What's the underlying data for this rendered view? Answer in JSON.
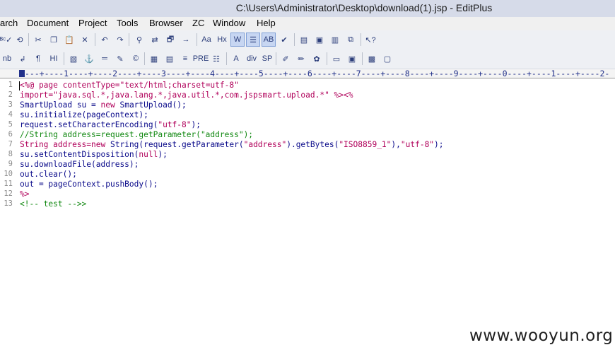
{
  "window": {
    "title": "C:\\Users\\Administrator\\Desktop\\download(1).jsp - EditPlus"
  },
  "menu": [
    "arch",
    "Document",
    "Project",
    "Tools",
    "Browser",
    "ZC",
    "Window",
    "Help"
  ],
  "toolbar1": {
    "buttons": [
      {
        "icon": "spell-check-icon",
        "glyph": "ᴬᴮᶜ✓"
      },
      {
        "icon": "browser-preview-icon",
        "glyph": "⟲"
      },
      {
        "icon": "cut-icon",
        "glyph": "✂"
      },
      {
        "icon": "copy-icon",
        "glyph": "❐"
      },
      {
        "icon": "paste-icon",
        "glyph": "📋"
      },
      {
        "icon": "delete-icon",
        "glyph": "✕"
      },
      {
        "icon": "undo-icon",
        "glyph": "↶"
      },
      {
        "icon": "redo-icon",
        "glyph": "↷"
      },
      {
        "icon": "find-icon",
        "glyph": "⚲"
      },
      {
        "icon": "replace-icon",
        "glyph": "⇄"
      },
      {
        "icon": "find-in-files-icon",
        "glyph": "🗗"
      },
      {
        "icon": "goto-line-icon",
        "glyph": "→"
      },
      {
        "icon": "font-icon",
        "glyph": "Aa"
      },
      {
        "icon": "hex-icon",
        "glyph": "Hx"
      },
      {
        "icon": "word-wrap-icon",
        "glyph": "W"
      },
      {
        "icon": "indent-icon",
        "glyph": "☰"
      },
      {
        "icon": "abc-sort-icon",
        "glyph": "AB"
      },
      {
        "icon": "check-icon",
        "glyph": "✔"
      },
      {
        "icon": "directory-icon",
        "glyph": "▤"
      },
      {
        "icon": "cliptext-icon",
        "glyph": "▣"
      },
      {
        "icon": "output-window-icon",
        "glyph": "▥"
      },
      {
        "icon": "window-icon",
        "glyph": "⧉"
      },
      {
        "icon": "help-icon",
        "glyph": "↖?"
      }
    ]
  },
  "toolbar2": {
    "buttons": [
      {
        "icon": "nbsp-icon",
        "glyph": "nb"
      },
      {
        "icon": "line-break-icon",
        "glyph": "↲"
      },
      {
        "icon": "paragraph-icon",
        "glyph": "¶"
      },
      {
        "icon": "heading-icon",
        "glyph": "HI"
      },
      {
        "icon": "image-icon",
        "glyph": "▧"
      },
      {
        "icon": "anchor-icon",
        "glyph": "⚓"
      },
      {
        "icon": "horizontal-rule-icon",
        "glyph": "═"
      },
      {
        "icon": "pencil-icon",
        "glyph": "✎"
      },
      {
        "icon": "copyright-icon",
        "glyph": "©"
      },
      {
        "icon": "table-icon",
        "glyph": "▦"
      },
      {
        "icon": "table-row-icon",
        "glyph": "▤"
      },
      {
        "icon": "center-icon",
        "glyph": "≡"
      },
      {
        "icon": "pre-icon",
        "glyph": "PRE"
      },
      {
        "icon": "list-icon",
        "glyph": "☷"
      },
      {
        "icon": "font-tag-icon",
        "glyph": "A"
      },
      {
        "icon": "div-icon",
        "glyph": "div"
      },
      {
        "icon": "span-icon",
        "glyph": "SP"
      },
      {
        "icon": "edit-icon",
        "glyph": "✐"
      },
      {
        "icon": "comment-icon",
        "glyph": "✏"
      },
      {
        "icon": "color-icon",
        "glyph": "✿"
      },
      {
        "icon": "form-icon",
        "glyph": "▭"
      },
      {
        "icon": "frame-icon",
        "glyph": "▣"
      },
      {
        "icon": "color-picker-icon",
        "glyph": "▩"
      },
      {
        "icon": "panel-icon",
        "glyph": "▢"
      }
    ]
  },
  "ruler": "---+----1----+----2----+----3----+----4----+----5----+----6----+----7----+----8----+----9----+----0----+----1----+----2-",
  "code": {
    "line_numbers": [
      "1",
      "2",
      "3",
      "4",
      "5",
      "6",
      "7",
      "8",
      "9",
      "10",
      "11",
      "12",
      "13"
    ],
    "lines": [
      [
        {
          "t": "<%@ page contentType=",
          "c": "tag"
        },
        {
          "t": "\"text/html;charset=utf-8\"",
          "c": "str"
        }
      ],
      [
        {
          "t": "import=",
          "c": "tag"
        },
        {
          "t": "\"java.sql.*,java.lang.*,java.util.*,com.jspsmart.upload.*\"",
          "c": "str"
        },
        {
          "t": " %><%",
          "c": "tag"
        }
      ],
      [
        {
          "t": "SmartUpload su = ",
          "c": "def"
        },
        {
          "t": "new",
          "c": "kw"
        },
        {
          "t": " SmartUpload();",
          "c": "def"
        }
      ],
      [
        {
          "t": "su.initialize(pageContext);",
          "c": "def"
        }
      ],
      [
        {
          "t": "request.setCharacterEncoding(",
          "c": "def"
        },
        {
          "t": "\"utf-8\"",
          "c": "str"
        },
        {
          "t": ");",
          "c": "def"
        }
      ],
      [
        {
          "t": "//String address=request.getParameter(\"address\");",
          "c": "com"
        }
      ],
      [
        {
          "t": "String address=",
          "c": "kw"
        },
        {
          "t": "new",
          "c": "kw"
        },
        {
          "t": " String(request.getParameter(",
          "c": "def"
        },
        {
          "t": "\"address\"",
          "c": "str"
        },
        {
          "t": ").getBytes(",
          "c": "def"
        },
        {
          "t": "\"ISO8859_1\"",
          "c": "str"
        },
        {
          "t": "),",
          "c": "def"
        },
        {
          "t": "\"utf-8\"",
          "c": "str"
        },
        {
          "t": ");",
          "c": "def"
        }
      ],
      [
        {
          "t": "su.setContentDisposition(",
          "c": "def"
        },
        {
          "t": "null",
          "c": "kw"
        },
        {
          "t": ");",
          "c": "def"
        }
      ],
      [
        {
          "t": "su.downloadFile(address);",
          "c": "def"
        }
      ],
      [
        {
          "t": "out.clear();",
          "c": "def"
        }
      ],
      [
        {
          "t": "out = pageContext.pushBody();",
          "c": "def"
        }
      ],
      [
        {
          "t": "%>",
          "c": "tag"
        }
      ],
      [
        {
          "t": "<!-- test -->>",
          "c": "grn"
        }
      ]
    ]
  },
  "watermark": "www.wooyun.org"
}
